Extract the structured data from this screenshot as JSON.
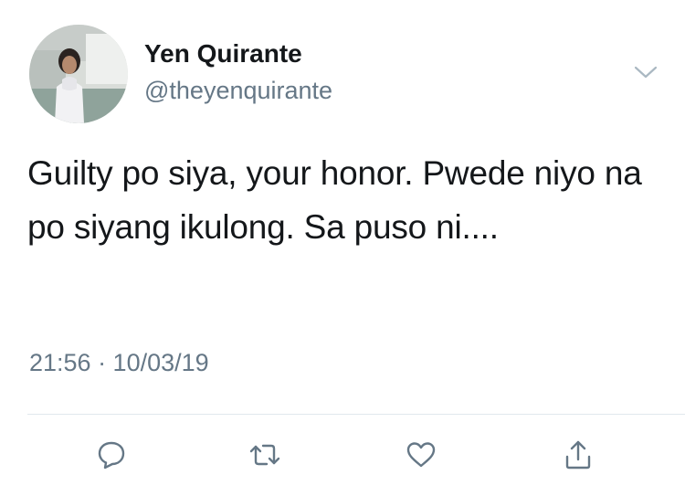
{
  "tweet": {
    "author_name": "Yen Quirante",
    "author_handle": "@theyenquirante",
    "text": "Guilty po siya, your honor. Pwede niyo na po siyang ikulong. Sa puso ni....",
    "timestamp": "21:56 · 10/03/19"
  },
  "icons": {
    "menu": "chevron-down-icon",
    "reply": "reply-icon",
    "retweet": "retweet-icon",
    "like": "heart-icon",
    "share": "share-icon"
  },
  "colors": {
    "text": "#14171a",
    "secondary": "#657786",
    "divider": "#e1e8ed",
    "icon": "#657786"
  }
}
